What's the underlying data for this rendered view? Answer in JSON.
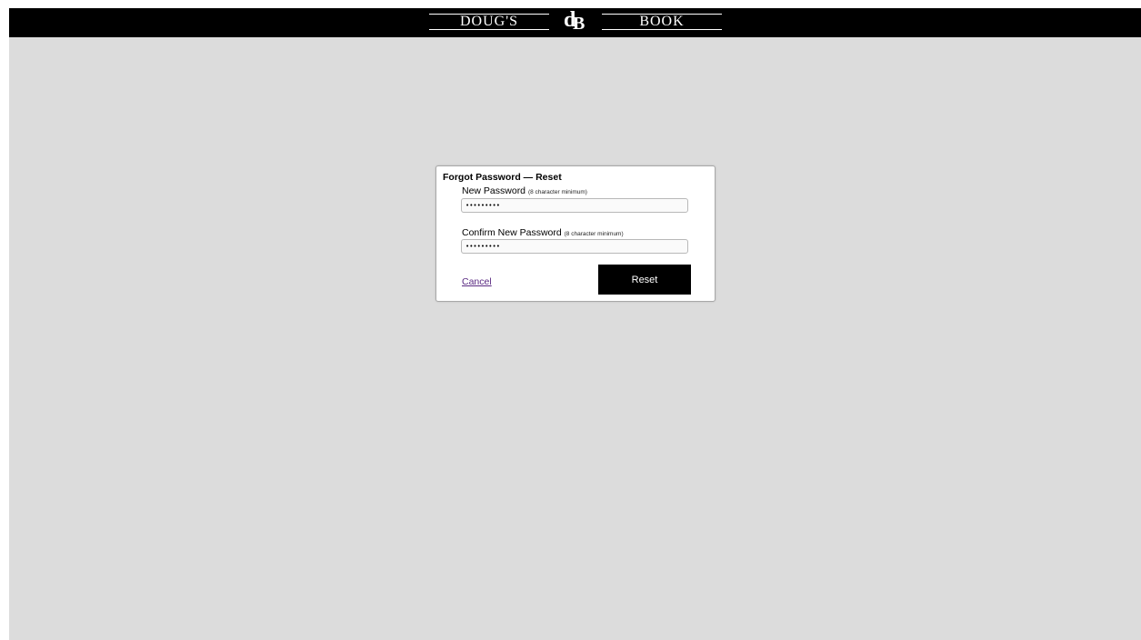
{
  "header": {
    "logo_left_word": "DOUG'S",
    "logo_monogram_d": "d",
    "logo_monogram_b": "B",
    "logo_right_word": "BOOK"
  },
  "dialog": {
    "title": "Forgot Password — Reset",
    "new_password": {
      "label": "New Password",
      "hint": "(8 character minimum)",
      "value": "•••••••••"
    },
    "confirm_password": {
      "label": "Confirm New Password",
      "hint": "(8 character minimum)",
      "value": "•••••••••"
    },
    "cancel_label": "Cancel",
    "reset_label": "Reset"
  },
  "colors": {
    "header_background": "#000000",
    "page_background": "#dcdcdc",
    "button_background": "#000000",
    "link_color": "#5a2a82"
  }
}
